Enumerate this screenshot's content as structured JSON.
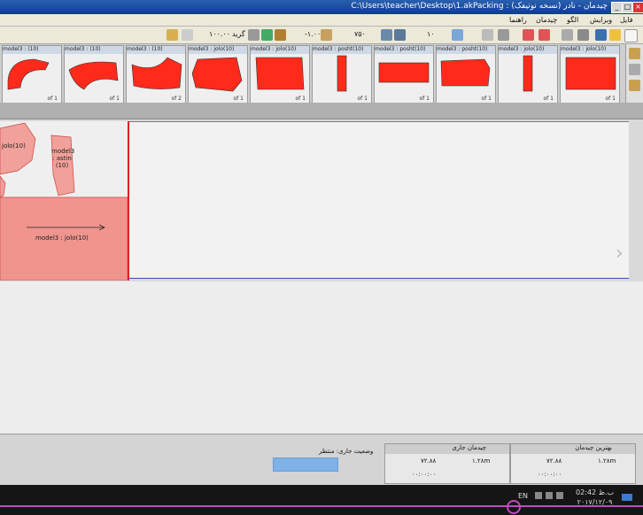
{
  "window": {
    "title": "C:\\Users\\teacher\\Desktop\\1.akPacking : (نسخه نوتیفک) چیدمان - نادر"
  },
  "menu": [
    "فایل",
    "ویرایش",
    "الگو",
    "چیدمان",
    "راهنما"
  ],
  "toolbar": {
    "zoom_label": "گرید",
    "zoom_value": "۱۰۰.۰۰",
    "offset_value": "-۱.۰۰",
    "width_value": "۷۵۰",
    "count_value": "۱۰"
  },
  "thumbnails": [
    {
      "title": "model3 : (10)",
      "count": "of 1"
    },
    {
      "title": "model3 : (10)",
      "count": "of 1"
    },
    {
      "title": "model3 : (10)",
      "count": "of 2"
    },
    {
      "title": "model3 : jolo(10)",
      "count": "of 1"
    },
    {
      "title": "model3 : jolo(10)",
      "count": "of 1"
    },
    {
      "title": "model3 : posht(10)",
      "count": "of 1"
    },
    {
      "title": "model3 : posht(10)",
      "count": "of 1"
    },
    {
      "title": "model3 : posht(10)",
      "count": "of 1"
    },
    {
      "title": "model3 : jolo(10)",
      "count": "of 1"
    },
    {
      "title": "model3 : jolo(10)",
      "count": "of 1"
    }
  ],
  "canvas": {
    "piece_labels": [
      "jolo(10)",
      "model3 : astin (10)",
      "model3 : jolo(10)"
    ]
  },
  "bottom": {
    "status_label": "وضعیت جاری: منتظر",
    "panel_best": {
      "title": "بهترین چیدمان",
      "value_a": "۱.۲۸m",
      "value_b": "۷۲.۸۸",
      "value_c": "۰۰:۰۰:۰۰"
    },
    "panel_current": {
      "title": "چیدمان جاری",
      "value_a": "۱.۲۸m",
      "value_b": "۷۲.۸۸",
      "value_c": "۰۰:۰۰:۰۰"
    }
  },
  "taskbar": {
    "lang": "EN",
    "time": "02:42 ب.ظ",
    "date": "۲۰۱۷/۱۲/۰۹"
  },
  "colors": {
    "piece_fill": "#ff2a1a",
    "selection": "#c04ac0"
  }
}
